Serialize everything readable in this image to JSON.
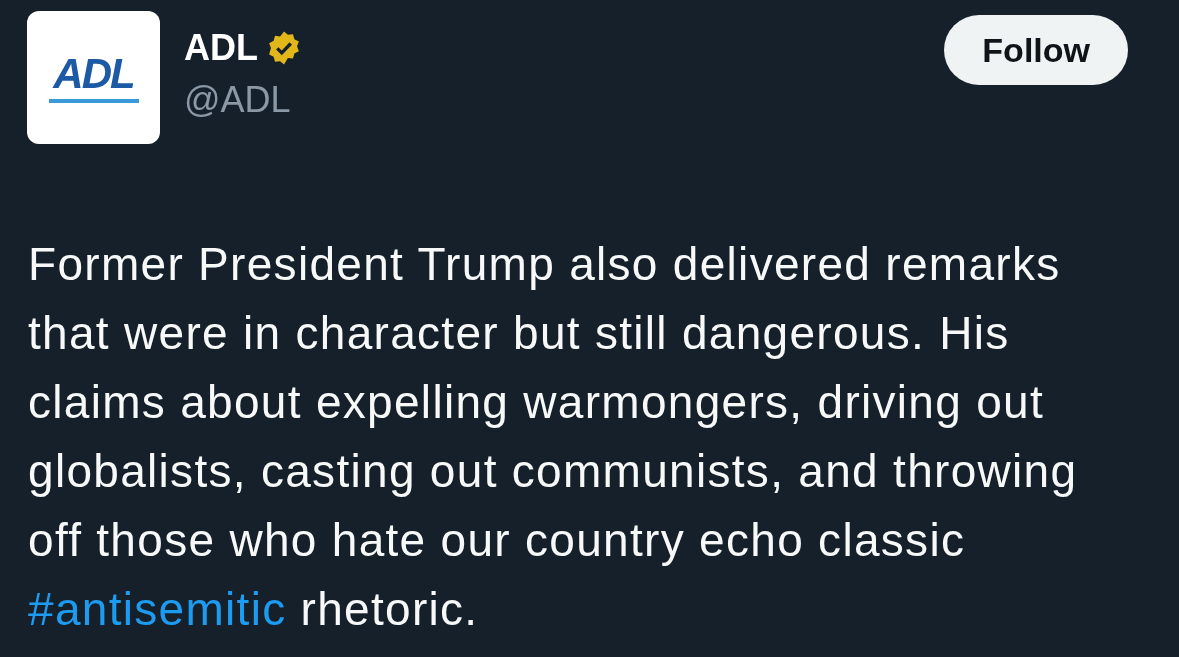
{
  "account": {
    "logo_text": "ADL",
    "name": "ADL",
    "verified": true,
    "handle": "@ADL"
  },
  "follow_button": {
    "label": "Follow"
  },
  "post": {
    "lines": [
      [
        {
          "kind": "text",
          "text": "Former President Trump also delivered remarks"
        }
      ],
      [
        {
          "kind": "text",
          "text": "that were in character but still dangerous. His"
        }
      ],
      [
        {
          "kind": "text",
          "text": "claims about expelling warmongers, driving out"
        }
      ],
      [
        {
          "kind": "text",
          "text": "globalists, casting out communists, and throwing"
        }
      ],
      [
        {
          "kind": "text",
          "text": "off those who hate our country echo classic"
        }
      ],
      [
        {
          "kind": "hashtag",
          "text": "#antisemitic"
        },
        {
          "kind": "text",
          "text": " rhetoric."
        }
      ]
    ]
  }
}
